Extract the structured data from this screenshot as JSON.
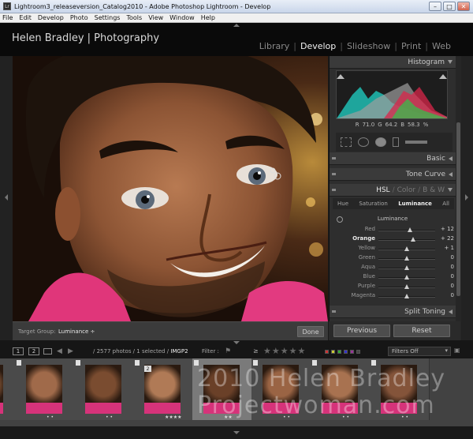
{
  "window": {
    "title": "Lightroom3_releaseversion_Catalog2010 - Adobe Photoshop Lightroom - Develop",
    "app_icon": "Lr",
    "controls": [
      "minimize",
      "maximize",
      "close"
    ]
  },
  "menu": [
    "File",
    "Edit",
    "Develop",
    "Photo",
    "Settings",
    "Tools",
    "View",
    "Window",
    "Help"
  ],
  "identity_plate": "Helen Bradley | Photography",
  "modules": {
    "library": "Library",
    "develop": "Develop",
    "slideshow": "Slideshow",
    "print": "Print",
    "web": "Web",
    "separator": "|",
    "active": "Develop"
  },
  "toolbar": {
    "target_group_label": "Target Group:",
    "target_group_value": "Luminance ÷",
    "done_label": "Done"
  },
  "right_panel": {
    "histogram": {
      "title": "Histogram",
      "r_label": "R",
      "r_value": "71.0",
      "g_label": "G",
      "g_value": "64.2",
      "b_label": "B",
      "b_value": "58.3",
      "percent": "%"
    },
    "basic_title": "Basic",
    "tone_curve_title": "Tone Curve",
    "hsl_header": {
      "hsl": "HSL",
      "sep1": "/",
      "color": "Color",
      "sep2": "/",
      "bw": "B & W"
    },
    "hsl_tabs": {
      "hue": "Hue",
      "saturation": "Saturation",
      "luminance": "Luminance",
      "all": "All",
      "active": "Luminance"
    },
    "luminance_title": "Luminance",
    "sliders": [
      {
        "label": "Red",
        "value": "+ 12",
        "level": 12
      },
      {
        "label": "Orange",
        "value": "+ 22",
        "level": 22,
        "bold": true
      },
      {
        "label": "Yellow",
        "value": "+ 1",
        "level": 1
      },
      {
        "label": "Green",
        "value": "0",
        "level": 0
      },
      {
        "label": "Aqua",
        "value": "0",
        "level": 0
      },
      {
        "label": "Blue",
        "value": "0",
        "level": 0
      },
      {
        "label": "Purple",
        "value": "0",
        "level": 0
      },
      {
        "label": "Magenta",
        "value": "0",
        "level": 0
      }
    ],
    "split_toning_title": "Split Toning",
    "previous_label": "Previous",
    "reset_label": "Reset"
  },
  "filmstrip_bar": {
    "view1": "1",
    "view2": "2",
    "source_text": "/ 2577 photos / 1 selected /",
    "source_file": "IMGP2",
    "filter_label": "Filter :",
    "rating_op": "≥",
    "stars": "★★★★★",
    "filters_off": "Filters Off"
  },
  "filmstrip": {
    "thumbs": [
      {
        "stars": "",
        "badge": "",
        "selected": false
      },
      {
        "stars": "• •",
        "badge": "",
        "selected": false
      },
      {
        "stars": "• •",
        "badge": "",
        "selected": false
      },
      {
        "stars": "★★★★",
        "badge": "2",
        "selected": false
      },
      {
        "stars": "★★",
        "badge": "",
        "selected": true
      },
      {
        "stars": "• •",
        "badge": "",
        "selected": false
      },
      {
        "stars": "• •",
        "badge": "",
        "selected": false
      },
      {
        "stars": "• •",
        "badge": "",
        "selected": false
      }
    ]
  },
  "watermark": {
    "line1": "2010 Helen Bradley",
    "line2": "Projectwoman.com"
  },
  "colors": {
    "identity_bg": "#0a0a0a",
    "panel_bg": "#2e2e2e",
    "accent_active": "#f2f2f2"
  }
}
